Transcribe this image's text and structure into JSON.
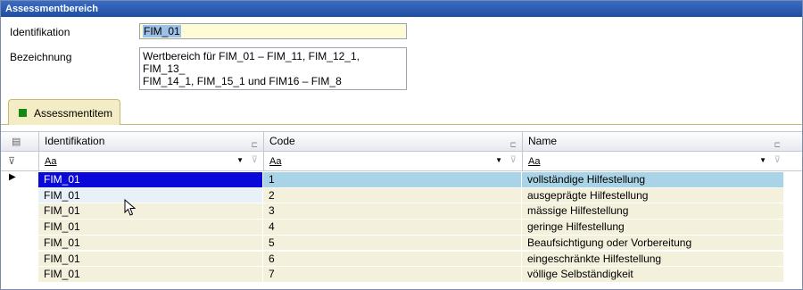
{
  "window": {
    "title": "Assessmentbereich"
  },
  "form": {
    "identifikation_label": "Identifikation",
    "identifikation_value": "FIM_01",
    "bezeichnung_label": "Bezeichnung",
    "bezeichnung_value": "Wertbereich für FIM_01 – FIM_11, FIM_12_1, FIM_13_\nFIM_14_1, FIM_15_1 und FIM16 – FIM_8"
  },
  "tab": {
    "label": "Assessmentitem",
    "color": "#118a11"
  },
  "grid": {
    "columns": [
      {
        "label": "Identifikation"
      },
      {
        "label": "Code"
      },
      {
        "label": "Name"
      }
    ],
    "filter_text": "Aa",
    "rows": [
      {
        "id": "FIM_01",
        "code": "1",
        "name": "vollständige Hilfestellung"
      },
      {
        "id": "FIM_01",
        "code": "2",
        "name": "ausgeprägte Hilfestellung"
      },
      {
        "id": "FIM_01",
        "code": "3",
        "name": "mässige Hilfestellung"
      },
      {
        "id": "FIM_01",
        "code": "4",
        "name": "geringe Hilfestellung"
      },
      {
        "id": "FIM_01",
        "code": "5",
        "name": "Beaufsichtigung oder Vorbereitung"
      },
      {
        "id": "FIM_01",
        "code": "6",
        "name": "eingeschränkte Hilfestellung"
      },
      {
        "id": "FIM_01",
        "code": "7",
        "name": "völlige Selbständigkeit"
      }
    ]
  }
}
